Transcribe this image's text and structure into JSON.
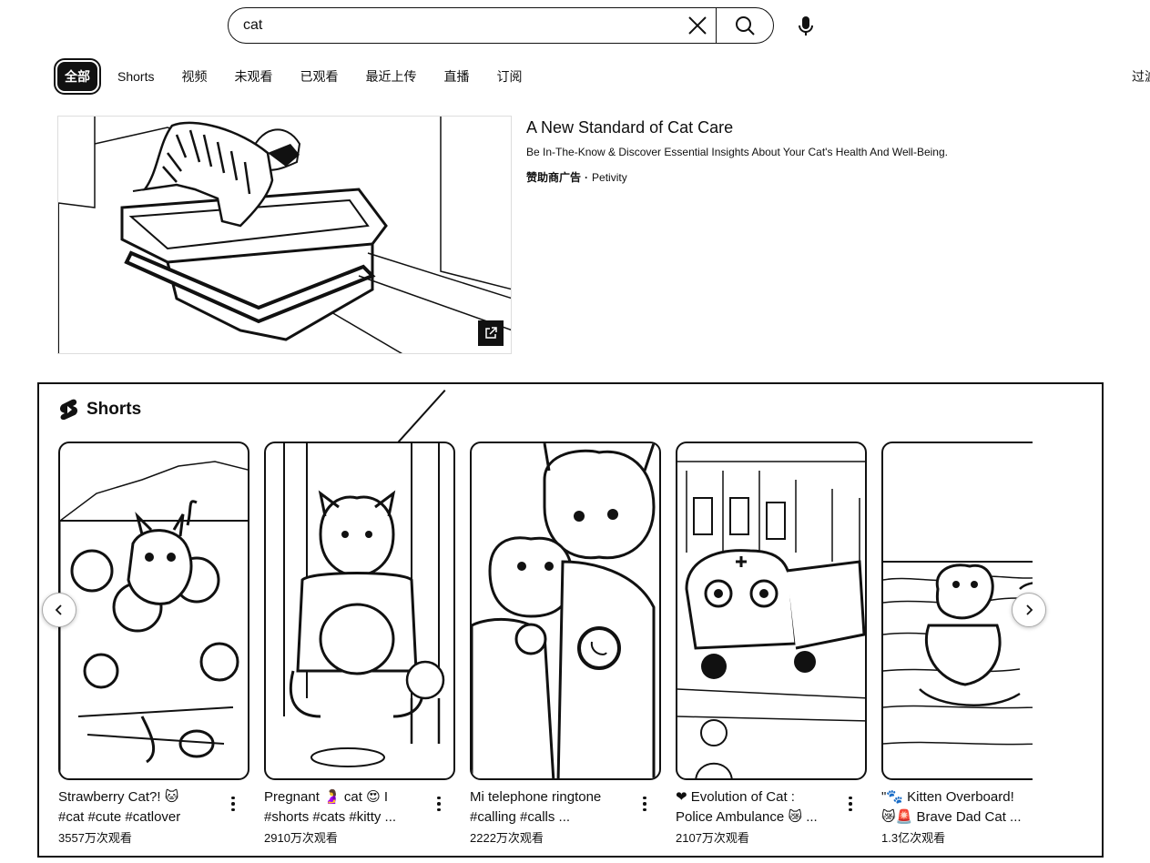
{
  "search": {
    "value": "cat",
    "clear_icon": "close-icon",
    "search_icon": "search-icon",
    "mic_icon": "microphone-icon"
  },
  "chips": [
    "全部",
    "Shorts",
    "视频",
    "未观看",
    "已观看",
    "最近上传",
    "直播",
    "订阅"
  ],
  "filter_label": "过滤",
  "ad": {
    "title": "A New Standard of Cat Care",
    "description": "Be In-The-Know & Discover Essential Insights About Your Cat's Health And Well-Being.",
    "label": "赞助商广告",
    "separator": "·",
    "advertiser": "Petivity"
  },
  "shorts": {
    "heading": "Shorts",
    "items": [
      {
        "line1": "Strawberry Cat?! 🐱",
        "line2": "#cat #cute #catlover",
        "views": "3557万次观看"
      },
      {
        "line1": "Pregnant 🤰 cat 😍 I",
        "line2": "#shorts #cats #kitty ...",
        "views": "2910万次观看"
      },
      {
        "line1": "Mi telephone ringtone",
        "line2": "#calling #calls ...",
        "views": "2222万次观看"
      },
      {
        "line1": "❤ Evolution of Cat :",
        "line2": "Police Ambulance 😿 ...",
        "views": "2107万次观看"
      },
      {
        "line1": "\"🐾 Kitten Overboard!",
        "line2": "😿🚨 Brave Dad Cat ...",
        "views": "1.3亿次观看"
      }
    ]
  }
}
